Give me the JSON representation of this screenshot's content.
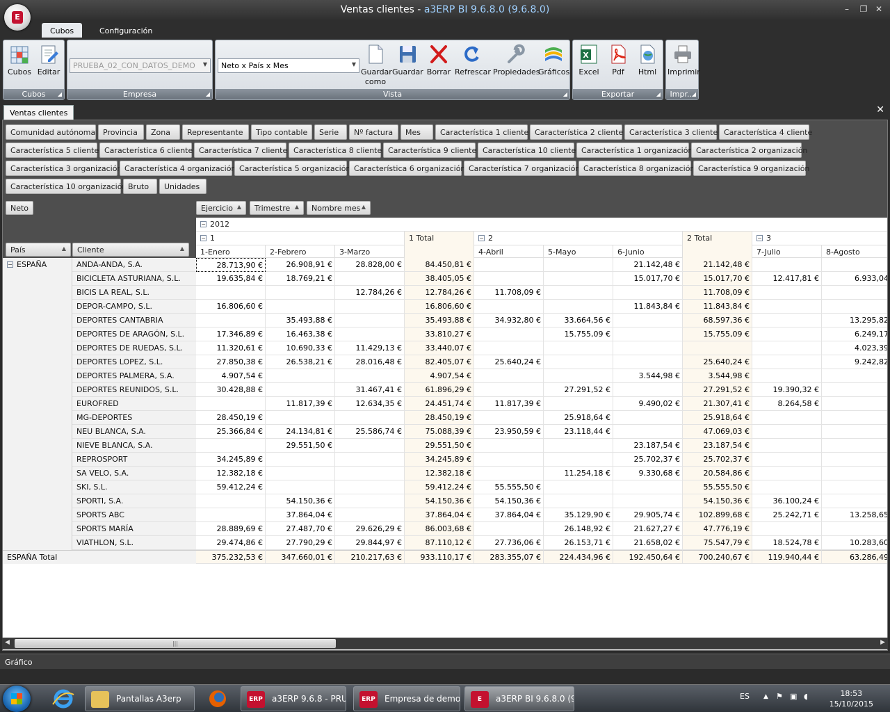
{
  "window": {
    "title_main": "Ventas clientes - ",
    "title_app": "a3ERP BI 9.6.8.0 (9.6.8.0)",
    "logo_letter": "E"
  },
  "ribbon_tabs": [
    "Cubos",
    "Configuración"
  ],
  "ribbon": {
    "cubos_group": {
      "label": "Cubos",
      "buttons": [
        "Cubos",
        "Editar"
      ]
    },
    "empresa_group": {
      "label": "Empresa",
      "value": "PRUEBA_02_CON_DATOS_DEMO"
    },
    "vista_group": {
      "label": "Vista",
      "view_value": "Neto x País x Mes",
      "buttons": [
        "Guardar como",
        "Guardar",
        "Borrar",
        "Refrescar",
        "Propiedades",
        "Gráficos"
      ]
    },
    "exportar_group": {
      "label": "Exportar",
      "buttons": [
        "Excel",
        "Pdf",
        "Html"
      ]
    },
    "imprimir_group": {
      "label": "Impr...",
      "buttons": [
        "Imprimir"
      ]
    }
  },
  "doc_tab": "Ventas clientes",
  "filter_fields": [
    [
      "Comunidad autónoma",
      "Provincia",
      "Zona",
      "Representante",
      "Tipo contable",
      "Serie",
      "Nº factura",
      "Mes",
      "Característica 1 cliente",
      "Característica 2 cliente",
      "Característica 3 cliente",
      "Característica 4 cliente"
    ],
    [
      "Característica 5 cliente",
      "Característica 6 cliente",
      "Característica 7 cliente",
      "Característica 8 cliente",
      "Característica 9 cliente",
      "Característica 10 cliente",
      "Característica 1 organización",
      "Característica 2 organización"
    ],
    [
      "Característica 3 organización",
      "Característica 4 organización",
      "Característica 5 organización",
      "Característica 6 organización",
      "Característica 7 organización",
      "Característica 8 organización",
      "Característica 9 organización"
    ],
    [
      "Característica 10 organización",
      "Bruto",
      "Unidades"
    ]
  ],
  "pivot": {
    "data_field": "Neto",
    "column_fields": [
      "Ejercicio",
      "Trimestre",
      "Nombre mes"
    ],
    "row_fields": [
      "País",
      "Cliente"
    ],
    "year": "2012",
    "quarters": [
      "1",
      "2",
      "3"
    ],
    "quarter_totals": [
      "1 Total",
      "2 Total"
    ],
    "months": [
      "1-Enero",
      "2-Febrero",
      "3-Marzo",
      "4-Abril",
      "5-Mayo",
      "6-Junio",
      "7-Julio",
      "8-Agosto"
    ],
    "country": "ESPAÑA",
    "rows": [
      {
        "client": "ANDA-ANDA, S.A.",
        "values": [
          "28.713,90 €",
          "26.908,91 €",
          "28.828,00 €",
          "84.450,81 €",
          "",
          "",
          "21.142,48 €",
          "21.142,48 €",
          "",
          ""
        ]
      },
      {
        "client": "BICICLETA ASTURIANA, S.L.",
        "values": [
          "19.635,84 €",
          "18.769,21 €",
          "",
          "38.405,05 €",
          "",
          "",
          "15.017,70 €",
          "15.017,70 €",
          "12.417,81 €",
          "6.933,04"
        ]
      },
      {
        "client": "BICIS LA REAL, S.L.",
        "values": [
          "",
          "",
          "12.784,26 €",
          "12.784,26 €",
          "11.708,09 €",
          "",
          "",
          "11.708,09 €",
          "",
          ""
        ]
      },
      {
        "client": "DEPOR-CAMPO, S.L.",
        "values": [
          "16.806,60 €",
          "",
          "",
          "16.806,60 €",
          "",
          "",
          "11.843,84 €",
          "11.843,84 €",
          "",
          ""
        ]
      },
      {
        "client": "DEPORTES CANTABRIA",
        "values": [
          "",
          "35.493,88 €",
          "",
          "35.493,88 €",
          "34.932,80 €",
          "33.664,56 €",
          "",
          "68.597,36 €",
          "",
          "13.295,82"
        ]
      },
      {
        "client": "DEPORTES DE ARAGÓN, S.L.",
        "values": [
          "17.346,89 €",
          "16.463,38 €",
          "",
          "33.810,27 €",
          "",
          "15.755,09 €",
          "",
          "15.755,09 €",
          "",
          "6.249,17"
        ]
      },
      {
        "client": "DEPORTES DE RUEDAS, S.L.",
        "values": [
          "11.320,61 €",
          "10.690,33 €",
          "11.429,13 €",
          "33.440,07 €",
          "",
          "",
          "",
          "",
          "",
          "4.023,39"
        ]
      },
      {
        "client": "DEPORTES LOPEZ, S.L.",
        "values": [
          "27.850,38 €",
          "26.538,21 €",
          "28.016,48 €",
          "82.405,07 €",
          "25.640,24 €",
          "",
          "",
          "25.640,24 €",
          "",
          "9.242,82"
        ]
      },
      {
        "client": "DEPORTES PALMERA, S.A.",
        "values": [
          "4.907,54 €",
          "",
          "",
          "4.907,54 €",
          "",
          "",
          "3.544,98 €",
          "3.544,98 €",
          "",
          ""
        ]
      },
      {
        "client": "DEPORTES REUNIDOS, S.L.",
        "values": [
          "30.428,88 €",
          "",
          "31.467,41 €",
          "61.896,29 €",
          "",
          "27.291,52 €",
          "",
          "27.291,52 €",
          "19.390,32 €",
          ""
        ]
      },
      {
        "client": "EUROFRED",
        "values": [
          "",
          "11.817,39 €",
          "12.634,35 €",
          "24.451,74 €",
          "11.817,39 €",
          "",
          "9.490,02 €",
          "21.307,41 €",
          "8.264,58 €",
          ""
        ]
      },
      {
        "client": "MG-DEPORTES",
        "values": [
          "28.450,19 €",
          "",
          "",
          "28.450,19 €",
          "",
          "25.918,64 €",
          "",
          "25.918,64 €",
          "",
          ""
        ]
      },
      {
        "client": "NEU BLANCA, S.A.",
        "values": [
          "25.366,84 €",
          "24.134,81 €",
          "25.586,74 €",
          "75.088,39 €",
          "23.950,59 €",
          "23.118,44 €",
          "",
          "47.069,03 €",
          "",
          ""
        ]
      },
      {
        "client": "NIEVE BLANCA, S.A.",
        "values": [
          "",
          "29.551,50 €",
          "",
          "29.551,50 €",
          "",
          "",
          "23.187,54 €",
          "23.187,54 €",
          "",
          ""
        ]
      },
      {
        "client": "REPROSPORT",
        "values": [
          "34.245,89 €",
          "",
          "",
          "34.245,89 €",
          "",
          "",
          "25.702,37 €",
          "25.702,37 €",
          "",
          ""
        ]
      },
      {
        "client": "SA VELO, S.A.",
        "values": [
          "12.382,18 €",
          "",
          "",
          "12.382,18 €",
          "",
          "11.254,18 €",
          "9.330,68 €",
          "20.584,86 €",
          "",
          ""
        ]
      },
      {
        "client": "SKI, S.L.",
        "values": [
          "59.412,24 €",
          "",
          "",
          "59.412,24 €",
          "55.555,50 €",
          "",
          "",
          "55.555,50 €",
          "",
          ""
        ]
      },
      {
        "client": "SPORTI, S.A.",
        "values": [
          "",
          "54.150,36 €",
          "",
          "54.150,36 €",
          "54.150,36 €",
          "",
          "",
          "54.150,36 €",
          "36.100,24 €",
          ""
        ]
      },
      {
        "client": "SPORTS ABC",
        "values": [
          "",
          "37.864,04 €",
          "",
          "37.864,04 €",
          "37.864,04 €",
          "35.129,90 €",
          "29.905,74 €",
          "102.899,68 €",
          "25.242,71 €",
          "13.258,65"
        ]
      },
      {
        "client": "SPORTS MARÍA",
        "values": [
          "28.889,69 €",
          "27.487,70 €",
          "29.626,29 €",
          "86.003,68 €",
          "",
          "26.148,92 €",
          "21.627,27 €",
          "47.776,19 €",
          "",
          ""
        ]
      },
      {
        "client": "VIATHLON, S.L.",
        "values": [
          "29.474,86 €",
          "27.790,29 €",
          "29.844,97 €",
          "87.110,12 €",
          "27.736,06 €",
          "26.153,71 €",
          "21.658,02 €",
          "75.547,79 €",
          "18.524,78 €",
          "10.283,60"
        ]
      }
    ],
    "total_label": "ESPAÑA Total",
    "totals": [
      "375.232,53 €",
      "347.660,01 €",
      "210.217,63 €",
      "933.110,17 €",
      "283.355,07 €",
      "224.434,96 €",
      "192.450,64 €",
      "700.240,67 €",
      "119.940,44 €",
      "63.286,49"
    ]
  },
  "bottom_panel": "Gráfico",
  "taskbar": {
    "items": [
      "Pantallas A3erp",
      "a3ERP 9.6.8 - PRU...",
      "Empresa de demo...",
      "a3ERP BI 9.6.8.0 (9..."
    ],
    "icon_labels": [
      "ERP",
      "ERP",
      "E"
    ],
    "lang": "ES",
    "time": "18:53",
    "date": "15/10/2015"
  }
}
